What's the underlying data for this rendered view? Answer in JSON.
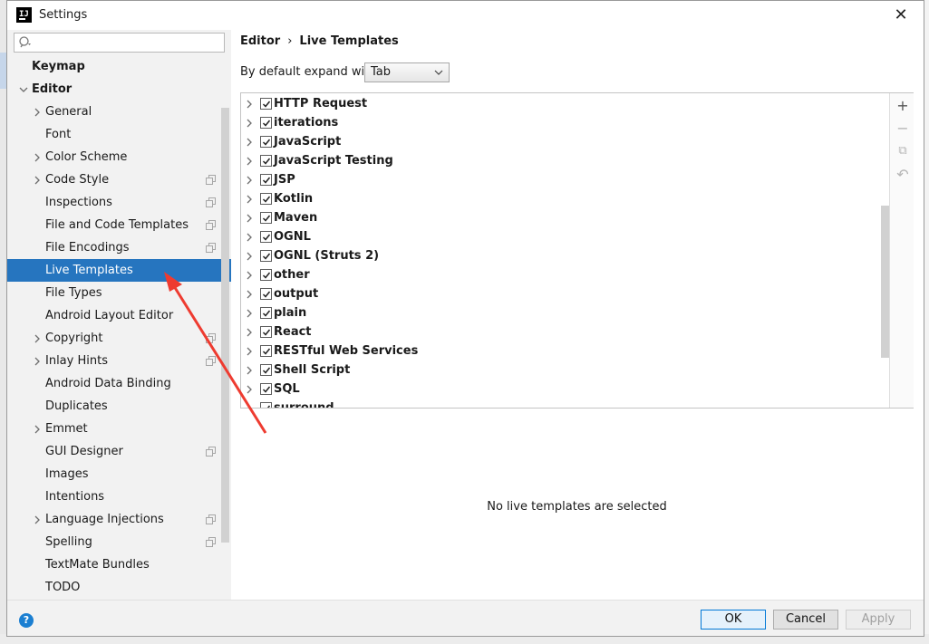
{
  "window": {
    "title": "Settings",
    "logo_text": "IJ"
  },
  "search": {
    "placeholder": "",
    "value": ""
  },
  "sidebar": {
    "items": [
      {
        "label": "Keymap",
        "depth": 0,
        "bold": true,
        "chevron": "none",
        "copy": false
      },
      {
        "label": "Editor",
        "depth": 0,
        "bold": true,
        "chevron": "down",
        "copy": false
      },
      {
        "label": "General",
        "depth": 1,
        "chevron": "right",
        "copy": false
      },
      {
        "label": "Font",
        "depth": 1,
        "chevron": "none",
        "copy": false
      },
      {
        "label": "Color Scheme",
        "depth": 1,
        "chevron": "right",
        "copy": false
      },
      {
        "label": "Code Style",
        "depth": 1,
        "chevron": "right",
        "copy": true
      },
      {
        "label": "Inspections",
        "depth": 1,
        "chevron": "none",
        "copy": true
      },
      {
        "label": "File and Code Templates",
        "depth": 1,
        "chevron": "none",
        "copy": true
      },
      {
        "label": "File Encodings",
        "depth": 1,
        "chevron": "none",
        "copy": true
      },
      {
        "label": "Live Templates",
        "depth": 1,
        "chevron": "none",
        "copy": false,
        "selected": true
      },
      {
        "label": "File Types",
        "depth": 1,
        "chevron": "none",
        "copy": false
      },
      {
        "label": "Android Layout Editor",
        "depth": 1,
        "chevron": "none",
        "copy": false
      },
      {
        "label": "Copyright",
        "depth": 1,
        "chevron": "right",
        "copy": true
      },
      {
        "label": "Inlay Hints",
        "depth": 1,
        "chevron": "right",
        "copy": true
      },
      {
        "label": "Android Data Binding",
        "depth": 1,
        "chevron": "none",
        "copy": false
      },
      {
        "label": "Duplicates",
        "depth": 1,
        "chevron": "none",
        "copy": false
      },
      {
        "label": "Emmet",
        "depth": 1,
        "chevron": "right",
        "copy": false
      },
      {
        "label": "GUI Designer",
        "depth": 1,
        "chevron": "none",
        "copy": true
      },
      {
        "label": "Images",
        "depth": 1,
        "chevron": "none",
        "copy": false
      },
      {
        "label": "Intentions",
        "depth": 1,
        "chevron": "none",
        "copy": false
      },
      {
        "label": "Language Injections",
        "depth": 1,
        "chevron": "right",
        "copy": true
      },
      {
        "label": "Spelling",
        "depth": 1,
        "chevron": "none",
        "copy": true
      },
      {
        "label": "TextMate Bundles",
        "depth": 1,
        "chevron": "none",
        "copy": false
      },
      {
        "label": "TODO",
        "depth": 1,
        "chevron": "none",
        "copy": false
      }
    ]
  },
  "breadcrumb": {
    "root": "Editor",
    "separator": "›",
    "current": "Live Templates"
  },
  "expand": {
    "label": "By default expand with",
    "value": "Tab"
  },
  "templates": [
    {
      "label": "HTTP Request",
      "checked": true
    },
    {
      "label": "iterations",
      "checked": true
    },
    {
      "label": "JavaScript",
      "checked": true
    },
    {
      "label": "JavaScript Testing",
      "checked": true
    },
    {
      "label": "JSP",
      "checked": true
    },
    {
      "label": "Kotlin",
      "checked": true
    },
    {
      "label": "Maven",
      "checked": true
    },
    {
      "label": "OGNL",
      "checked": true
    },
    {
      "label": "OGNL (Struts 2)",
      "checked": true
    },
    {
      "label": "other",
      "checked": true
    },
    {
      "label": "output",
      "checked": true
    },
    {
      "label": "plain",
      "checked": true
    },
    {
      "label": "React",
      "checked": true
    },
    {
      "label": "RESTful Web Services",
      "checked": true
    },
    {
      "label": "Shell Script",
      "checked": true
    },
    {
      "label": "SQL",
      "checked": true
    },
    {
      "label": "surround",
      "checked": true
    }
  ],
  "toolbar": {
    "add": "+",
    "remove": "−",
    "copy": "⧉",
    "restore": "↶"
  },
  "detail": {
    "empty_message": "No live templates are selected"
  },
  "footer": {
    "help": "?",
    "ok": "OK",
    "cancel": "Cancel",
    "apply": "Apply"
  },
  "colors": {
    "selection": "#2675bf",
    "annotation": "#ee3b30",
    "primary_border": "#0078d7"
  }
}
